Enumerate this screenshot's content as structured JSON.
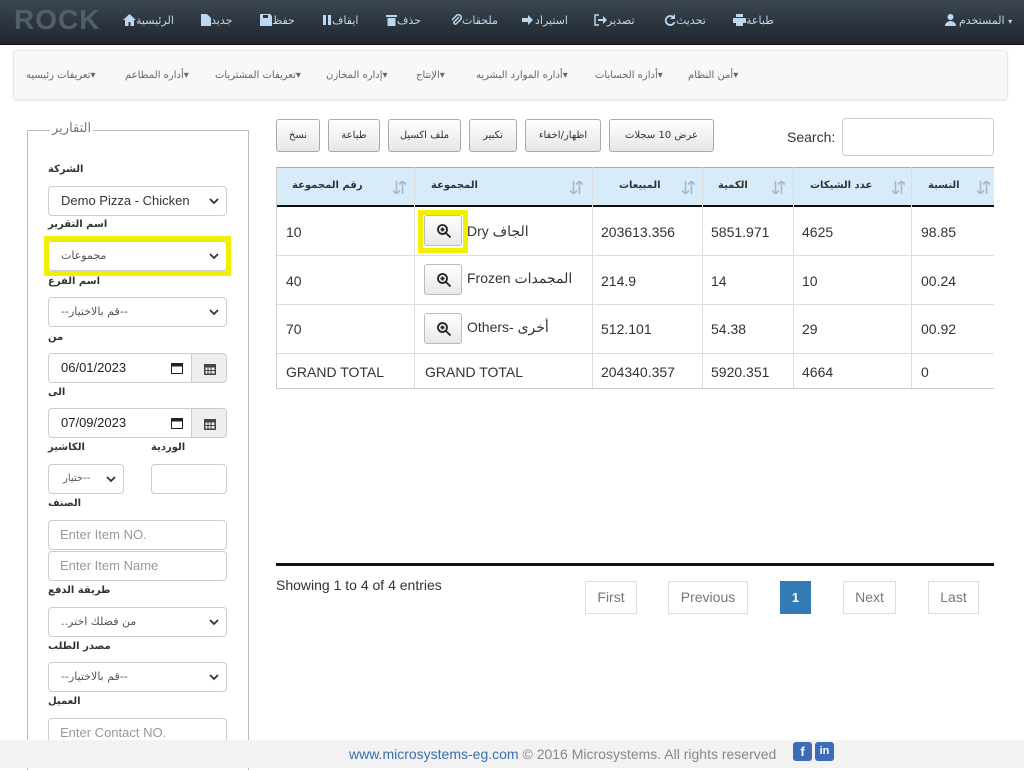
{
  "app": {
    "logo": "ROCK"
  },
  "toolbar": {
    "user": "المستخدم",
    "print": "طباعة",
    "refresh": "تحديث",
    "export": "تصدير",
    "import": "استيراد",
    "attachments": "ملحقات",
    "delete": "حذف",
    "stop": "ايقاف",
    "save": "حفظ",
    "new": "جديد",
    "home": "الرئيسية"
  },
  "menu": {
    "items": [
      "أمن النظام",
      "أداره الحسابات",
      "أداره الموارد البشريه",
      "الإنتاج",
      "إداره المخازن",
      "تعريفات المشتريات",
      "أداره المطاعم",
      "تعريفات رئيسيه"
    ]
  },
  "filters": {
    "legend": "التقارير",
    "company_label": "الشركة",
    "company_value": "Demo Pizza - Chicken",
    "report_label": "اسم التقرير",
    "report_value": "مجموعات",
    "branch_label": "اسم الفرع",
    "branch_value": "--قم بالاختيار--",
    "from_label": "من",
    "from_value": "06/01/2023",
    "to_label": "الى",
    "to_value": "07/09/2023",
    "cashier_label": "الكاشير",
    "cashier_value": "ختيار--",
    "shift_label": "الوردية",
    "item_label": "الصنف",
    "item_no_placeholder": "Enter Item NO.",
    "item_name_placeholder": "Enter Item Name",
    "payment_label": "طريقة الدفع",
    "payment_value": "..من فضلك اختر",
    "order_source_label": "مصدر الطلب",
    "order_source_value": "--قم بالاختيار--",
    "client_label": "العميل",
    "contact_placeholder": "Enter Contact NO."
  },
  "actions": {
    "show10": "عرض 10 سجلات",
    "toggle": "اظهار/اخفاء",
    "zoom": "تكبير",
    "excel": "ملف اكسيل",
    "print": "طباعة",
    "copy": "نسخ",
    "search_label": "Search:"
  },
  "table": {
    "headers": [
      "رقم المجموعة",
      "المجموعة",
      "المبيعات",
      "الكمية",
      "عدد الشيكات",
      "النسبة"
    ],
    "rows": [
      {
        "group_no": "10",
        "group": "Dry الجاف",
        "sales": "203613.356",
        "qty": "5851.971",
        "checks": "4625",
        "pct": "98.85"
      },
      {
        "group_no": "40",
        "group": "Frozen المجمدات",
        "sales": "214.9",
        "qty": "14",
        "checks": "10",
        "pct": "00.24"
      },
      {
        "group_no": "70",
        "group": "Others- أخرى",
        "sales": "512.101",
        "qty": "54.38",
        "checks": "29",
        "pct": "00.92"
      }
    ],
    "total": {
      "group_no": "GRAND TOTAL",
      "group": "GRAND TOTAL",
      "sales": "204340.357",
      "qty": "5920.351",
      "checks": "4664",
      "pct": "0"
    }
  },
  "pagination": {
    "info": "Showing 1 to 4 of 4 entries",
    "first": "First",
    "previous": "Previous",
    "current": "1",
    "next": "Next",
    "last": "Last"
  },
  "footer": {
    "link": "www.microsystems-eg.com",
    "text": "© 2016 Microsystems. All rights reserved",
    "facebook": "f",
    "linkedin": "in"
  },
  "colors": {
    "topbar": "#2b343d",
    "toolbar_text": "#bcd7f0",
    "table_header": "#d8ebf8",
    "highlight": "#f2ef00",
    "active_page": "#337ab7"
  }
}
